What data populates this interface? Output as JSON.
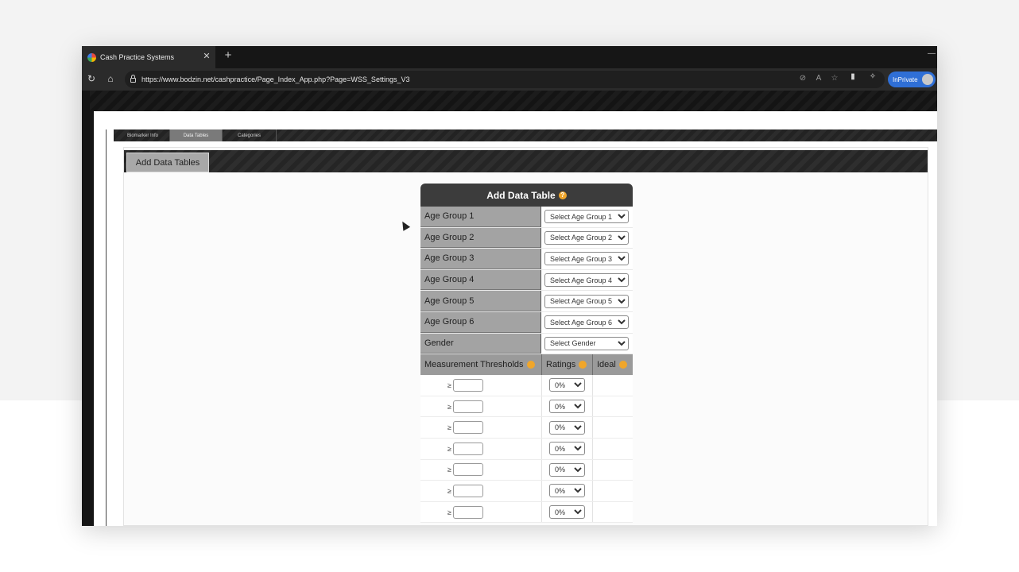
{
  "browser": {
    "tab_title": "Cash Practice Systems",
    "tab_close": "✕",
    "new_tab": "+",
    "url": "https://www.bodzin.net/cashpractice/Page_Index_App.php?Page=WSS_Settings_V3",
    "inprivate_label": "InPrivate"
  },
  "subnav": {
    "tabs": [
      {
        "label": "Biomarker Info"
      },
      {
        "label": "Data Tables"
      },
      {
        "label": "Categories"
      }
    ]
  },
  "section": {
    "tab_label": "Add Data Tables"
  },
  "form": {
    "title": "Add Data Table",
    "help_glyph": "?",
    "rows": [
      {
        "label": "Age Group 1",
        "select": "Select Age Group 1"
      },
      {
        "label": "Age Group 2",
        "select": "Select Age Group 2"
      },
      {
        "label": "Age Group 3",
        "select": "Select Age Group 3"
      },
      {
        "label": "Age Group 4",
        "select": "Select Age Group 4"
      },
      {
        "label": "Age Group 5",
        "select": "Select Age Group 5"
      },
      {
        "label": "Age Group 6",
        "select": "Select Age Group 6"
      },
      {
        "label": "Gender",
        "select": "Select Gender"
      }
    ],
    "headers": {
      "thresholds": "Measurement Thresholds",
      "ratings": "Ratings",
      "ideal": "Ideal"
    },
    "threshold_symbol": "≥",
    "rating_default": "0%"
  },
  "colors": {
    "accent_help": "#f0a62b",
    "inprivate": "#2f6fd6",
    "label_bg": "#a3a3a3"
  }
}
